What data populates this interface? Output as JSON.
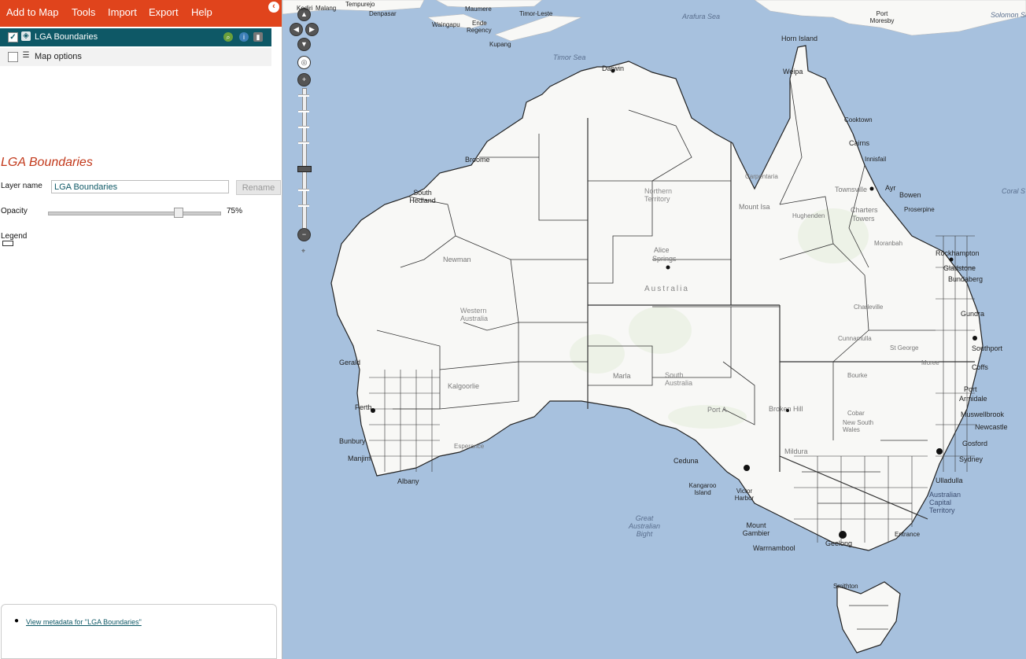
{
  "menu": {
    "add_to_map": "Add to Map",
    "tools": "Tools",
    "import": "Import",
    "export": "Export",
    "help": "Help"
  },
  "layers": {
    "lga": {
      "label": "LGA Boundaries",
      "checked": true
    },
    "map_options": {
      "label": "Map options",
      "checked": false
    }
  },
  "panel": {
    "title": "LGA Boundaries",
    "layer_name_label": "Layer name",
    "layer_name_value": "LGA Boundaries",
    "rename_label": "Rename",
    "opacity_label": "Opacity",
    "opacity_value": "75%",
    "opacity_level": 0.75,
    "legend_label": "Legend"
  },
  "metadata": {
    "link_text": "View metadata for \"LGA Boundaries\""
  },
  "colors": {
    "menubar": "#e0441c",
    "layer_selected": "#0e5866",
    "title": "#c2381a",
    "ocean": "#a7c1de",
    "land": "#f8f8f6"
  },
  "map": {
    "places": {
      "kediri": "Kediri",
      "malang": "Malang",
      "tempurejo": "Tempurejo",
      "denpasar": "Denpasar",
      "maumere": "Maumere",
      "timor_leste": "Timor-Leste",
      "waingapu": "Waingapu",
      "ende": "Ende",
      "regency": "Regency",
      "kupang": "Kupang",
      "port_moresby": "Port Moresby",
      "darwin": "Darwin",
      "broome": "Broome",
      "south_hedland": "South Hedland",
      "newman": "Newman",
      "alice": "Alice",
      "springs": "Springs",
      "geraldton": "Gerald",
      "perth": "Perth",
      "bunbury": "Bunbury",
      "manjimup": "Manjim",
      "albany": "Albany",
      "kalgoorlie": "Kalgoorlie",
      "esperance": "Esperance",
      "marla": "Marla",
      "port_augusta": "Port A",
      "broken_hill": "Broken Hill",
      "ceduna": "Ceduna",
      "kangaroo_island": "Kangaroo Island",
      "victor_harbor": "Victor Harbor",
      "mount_gambier": "Mount Gambier",
      "warrnambool": "Warrnambool",
      "geelong": "Geelong",
      "mildura": "Mildura",
      "smithton": "Smithton",
      "horn_island": "Horn Island",
      "weipa": "Weipa",
      "cooktown": "Cooktown",
      "cairns": "Cairns",
      "innisfail": "Innisfail",
      "ayr": "Ayr",
      "bowen": "Bowen",
      "townsville": "Townsville",
      "charters": "Charters",
      "towers": "Towers",
      "mount_isa": "Mount Isa",
      "hughenden": "Hughenden",
      "carpentaria": "Carpentaria",
      "proserpine": "Proserpine",
      "moranbah": "Moranbah",
      "rockhampton": "Rockhampton",
      "gladstone": "Gladstone",
      "bundaberg": "Bundaberg",
      "gundra": "Gundra",
      "southport": "Southport",
      "charleville": "Charleville",
      "cunnamulla": "Cunnamulla",
      "st_george": "St George",
      "moree": "Moree",
      "bourke": "Bourke",
      "cobar": "Cobar",
      "new_south_wales": "New South Wales",
      "armidale": "Armidale",
      "muswellbrook": "Muswellbrook",
      "newcastle": "Newcastle",
      "gosford": "Gosford",
      "sydney": "Sydney",
      "ulladulla": "Ulladulla",
      "entrance": "Entrance",
      "port": "Port",
      "coffs": "Coffs"
    },
    "seas": {
      "arafura": "Arafura Sea",
      "timor": "Timor Sea",
      "solomon": "Solomon Sea",
      "coral": "Coral S",
      "great_australian_bight": "Great Australian Bight"
    },
    "regions": {
      "northern_territory": "Northern Territory",
      "western_australia": "Western Australia",
      "south_australia": "South Australia",
      "australia": "Australia",
      "act": "Australian Capital Territory"
    }
  }
}
